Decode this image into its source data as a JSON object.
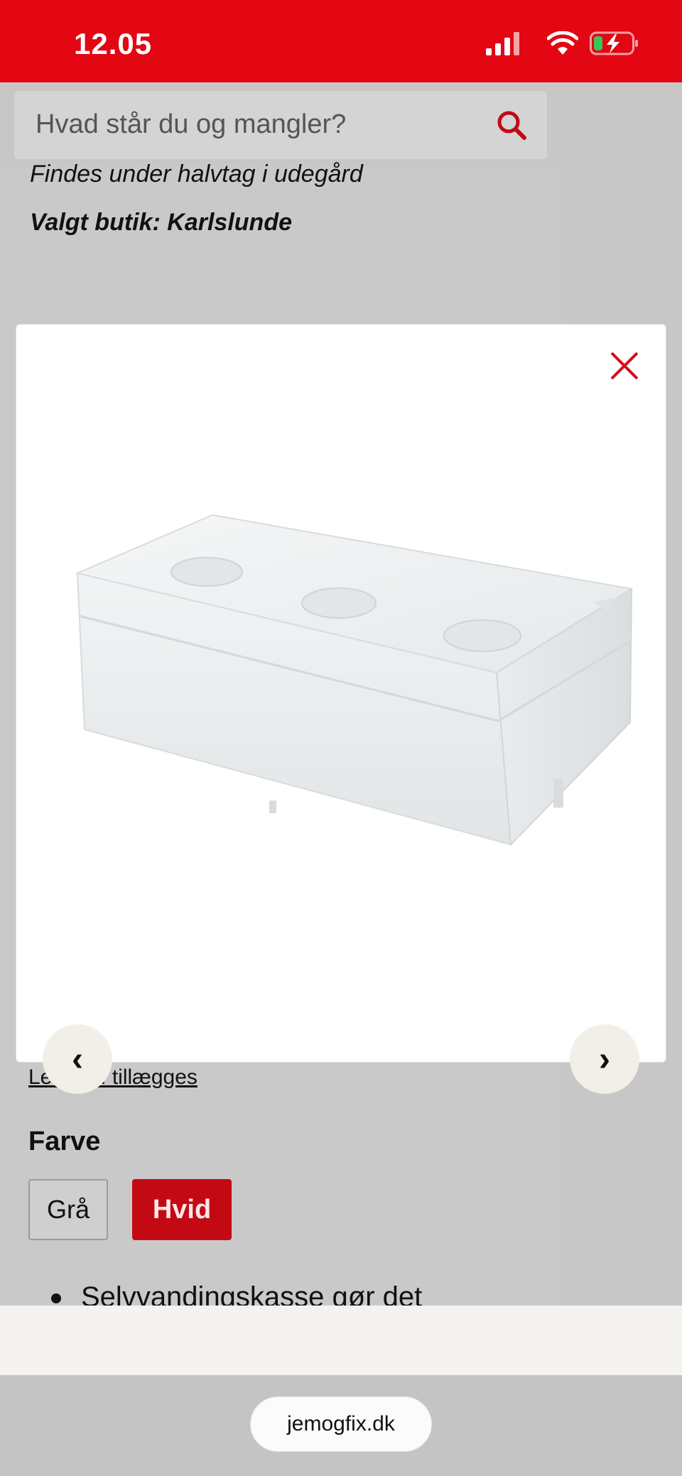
{
  "status_bar": {
    "time": "12.05",
    "background": "#e30613"
  },
  "search": {
    "placeholder": "Hvad står du og mangler?",
    "icon": "search-icon"
  },
  "product_info": {
    "location_text": "Findes under halvtag i udegård",
    "store_text": "Valgt butik: Karlslunde",
    "fees_link": "Lev. ink. tillægges"
  },
  "color_options": {
    "heading": "Farve",
    "options": [
      {
        "label": "Grå",
        "selected": false
      },
      {
        "label": "Hvid",
        "selected": true
      }
    ],
    "selected_color": "#c30a14"
  },
  "features": {
    "first_item": "Selvvandingskasse gør det"
  },
  "modal": {
    "close_icon": "close-icon",
    "image": "white styrofoam box with three round recesses",
    "prev_label": "‹",
    "next_label": "›",
    "accent": "#d0111b"
  },
  "browser": {
    "url": "jemogfix.dk"
  }
}
